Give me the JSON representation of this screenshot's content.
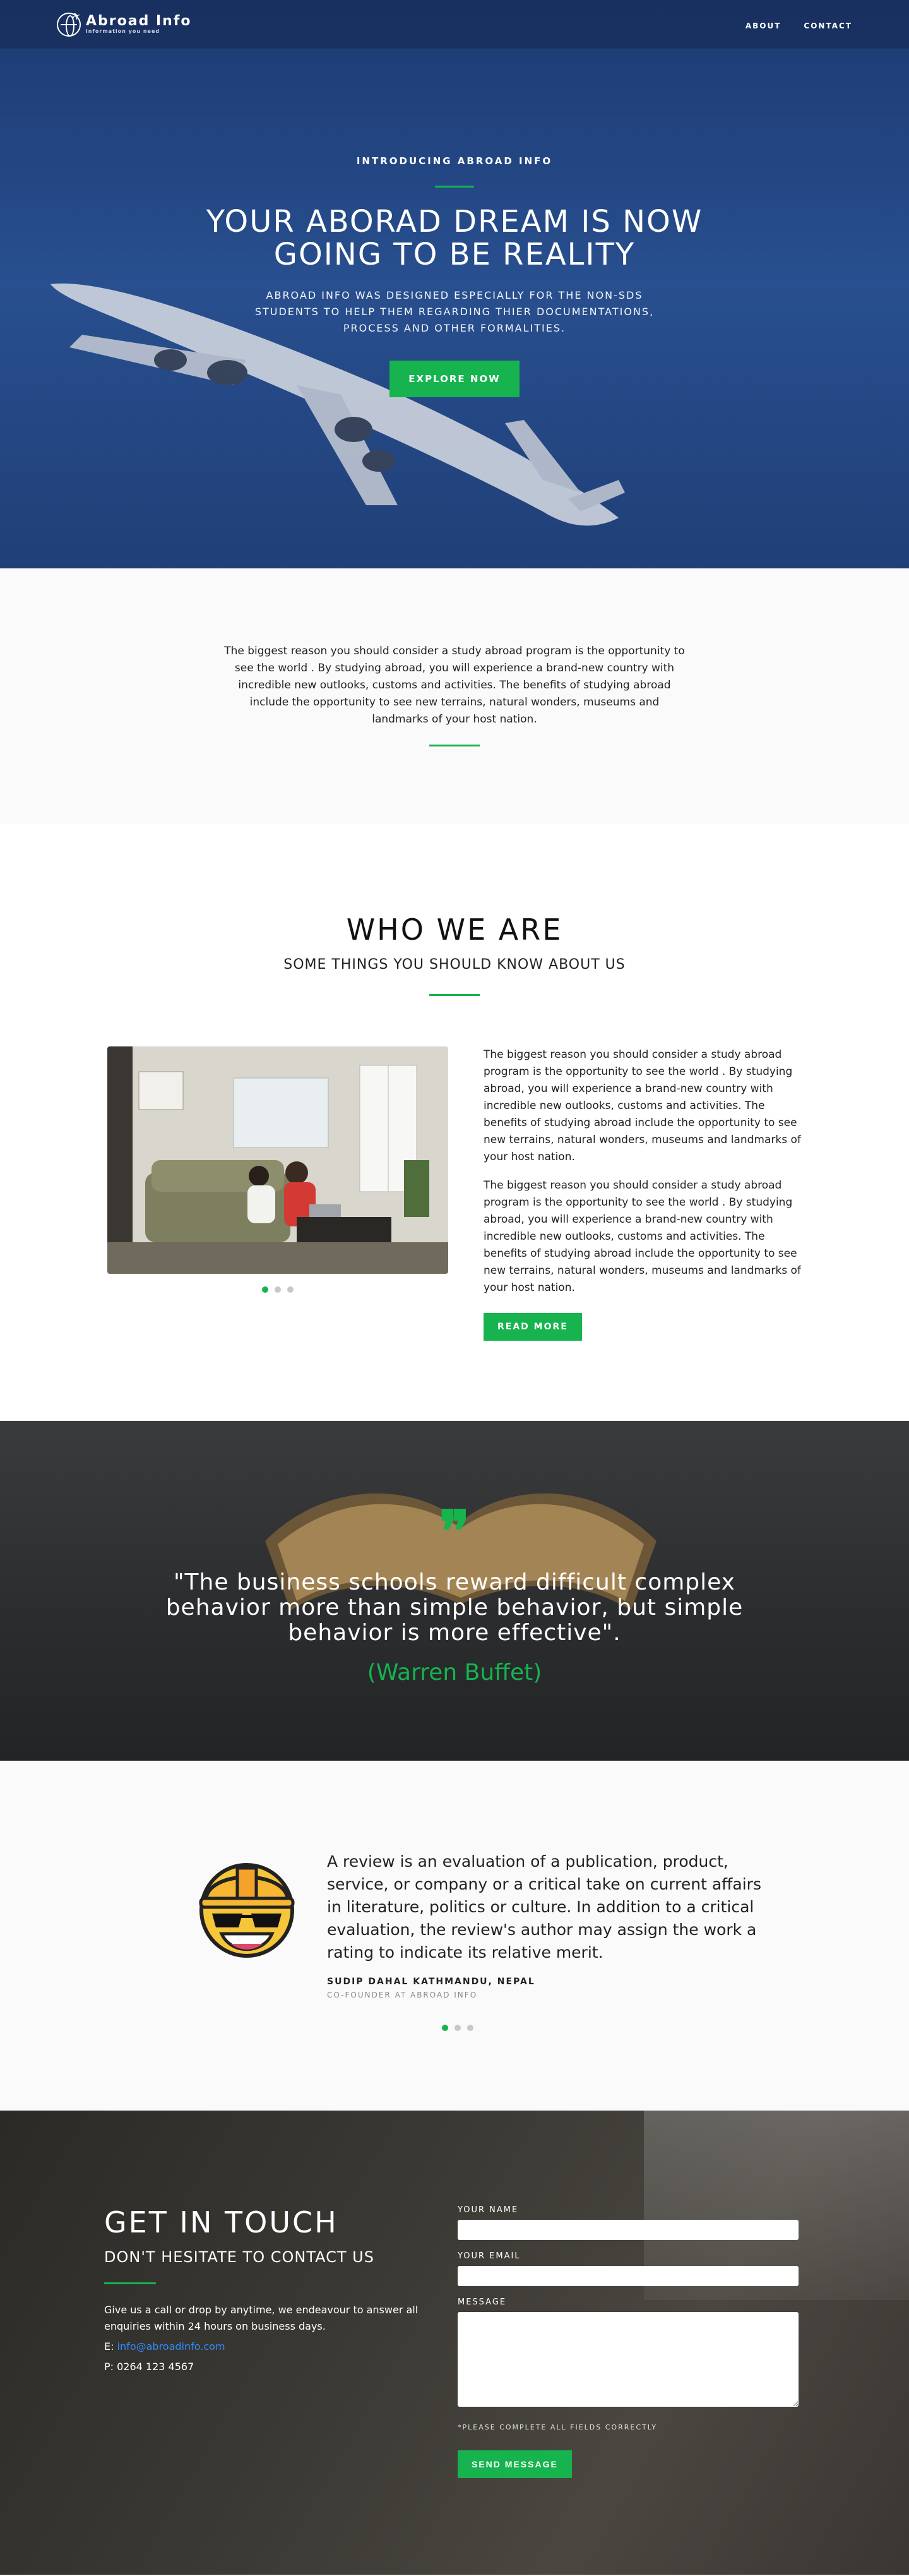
{
  "nav": {
    "logo_name": "Abroad Info",
    "logo_tagline": "information you need",
    "links": [
      "ABOUT",
      "CONTACT"
    ]
  },
  "hero": {
    "eyebrow": "INTRODUCING ABROAD INFO",
    "title": "YOUR ABORAD DREAM IS NOW GOING TO BE REALITY",
    "subtitle": "ABROAD INFO WAS DESIGNED ESPECIALLY FOR THE NON-SDS STUDENTS TO HELP THEM REGARDING THIER DOCUMENTATIONS, PROCESS AND OTHER FORMALITIES.",
    "cta": "EXPLORE NOW"
  },
  "intro": {
    "text": "The biggest reason you should consider a study abroad program is the opportunity to see the world . By studying abroad, you will experience a brand-new country with incredible new outlooks, customs and activities. The benefits of studying abroad include the opportunity to see new terrains, natural wonders, museums and landmarks of your host nation."
  },
  "who": {
    "title": "WHO WE ARE",
    "subtitle": "SOME THINGS YOU SHOULD KNOW ABOUT US",
    "paragraph_1": "The biggest reason you should consider a study abroad program is the opportunity to see the world . By studying abroad, you will experience a brand-new country with incredible new outlooks, customs and activities. The benefits of studying abroad include the opportunity to see new terrains, natural wonders, museums and landmarks of your host nation.",
    "paragraph_2": "The biggest reason you should consider a study abroad program is the opportunity to see the world . By studying abroad, you will experience a brand-new country with incredible new outlooks, customs and activities. The benefits of studying abroad include the opportunity to see new terrains, natural wonders, museums and landmarks of your host nation.",
    "cta": "READ MORE",
    "carousel_active": 0
  },
  "quote": {
    "text": "\"The business schools reward difficult complex behavior more than simple behavior, but simple behavior is more effective\".",
    "author": "(Warren Buffet)"
  },
  "review": {
    "text": "A review is an evaluation of a publication, product, service, or company or a critical take on current affairs in literature, politics or culture. In addition to a critical evaluation, the review's author may assign the work a rating to indicate its relative merit.",
    "name": "SUDIP DAHAL KATHMANDU, NEPAL",
    "role": "CO-FOUNDER AT ABROAD INFO",
    "avatar_icon": "construction-emoji-icon"
  },
  "contact": {
    "title": "GET IN TOUCH",
    "subtitle": "DON'T HESITATE TO CONTACT US",
    "description": "Give us a call or drop by anytime, we endeavour to answer all enquiries within 24 hours on business days.",
    "email_label": "E: ",
    "email": "info@abroadinfo.com",
    "phone": "P: 0264 123 4567",
    "form": {
      "name_label": "YOUR NAME",
      "email_label": "YOUR EMAIL",
      "message_label": "MESSAGE",
      "note": "*PLEASE COMPLETE ALL FIELDS CORRECTLY",
      "submit": "SEND MESSAGE"
    }
  },
  "colors": {
    "accent": "#16b34f",
    "hero_blue": "#234783",
    "link_blue": "#2f8cff"
  }
}
